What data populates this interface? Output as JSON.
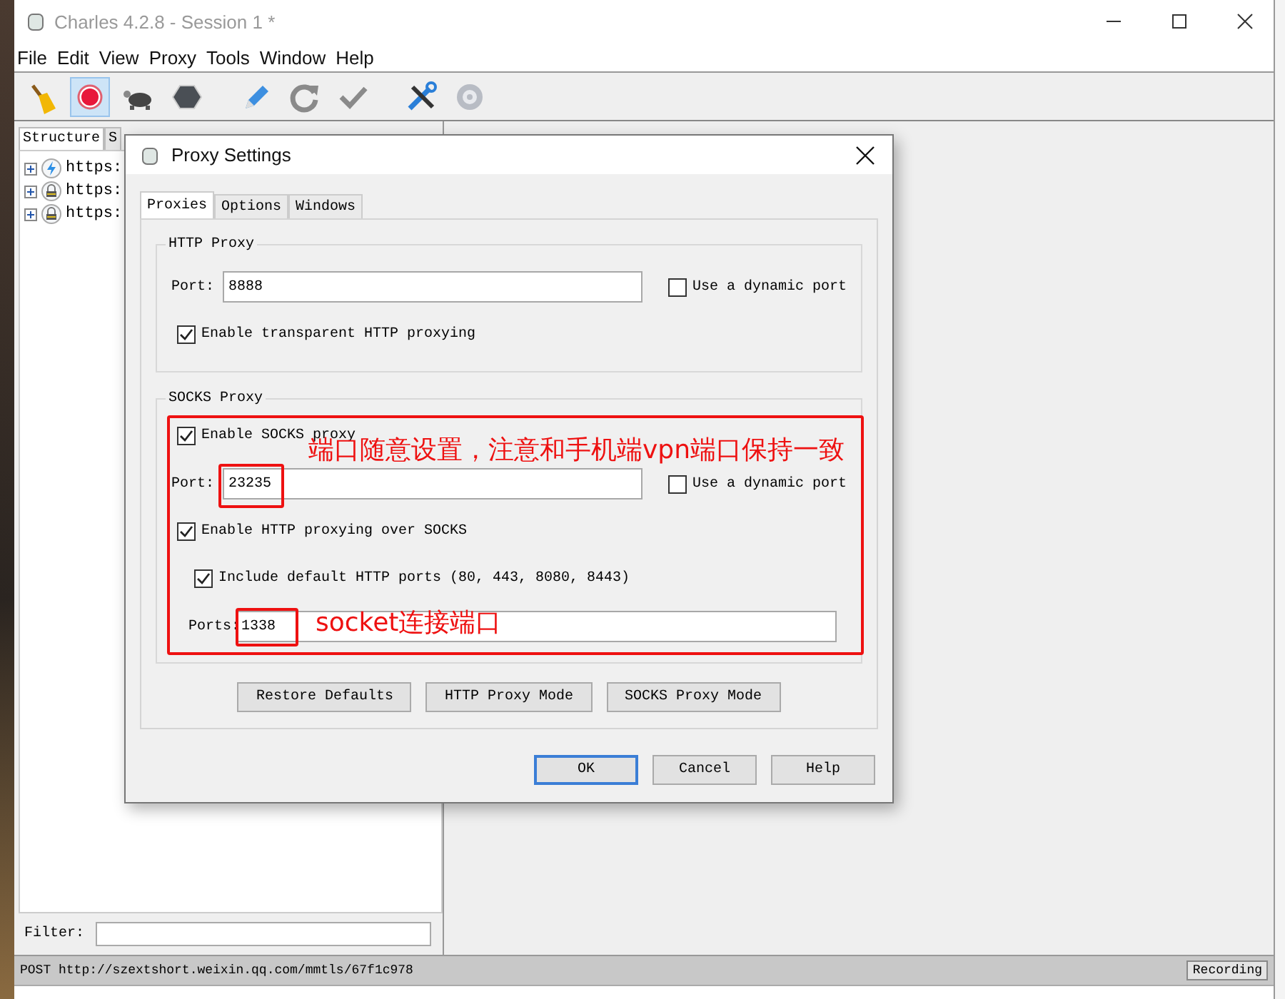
{
  "window": {
    "title": "Charles 4.2.8 - Session 1 *"
  },
  "menu": [
    "File",
    "Edit",
    "View",
    "Proxy",
    "Tools",
    "Window",
    "Help"
  ],
  "toolbar": [
    {
      "kind": "broom",
      "selected": false
    },
    {
      "kind": "record",
      "selected": true
    },
    {
      "kind": "turtle",
      "selected": false
    },
    {
      "kind": "stop",
      "selected": false
    },
    {
      "kind": "pen",
      "selected": false
    },
    {
      "kind": "refresh",
      "selected": false
    },
    {
      "kind": "check",
      "selected": false
    },
    {
      "kind": "tools",
      "selected": false
    },
    {
      "kind": "gear",
      "selected": false
    }
  ],
  "sidebar": {
    "tabs": [
      {
        "label": "Structure",
        "selected": true
      },
      {
        "label": "S",
        "selected": false
      }
    ],
    "tree": [
      {
        "label": "https:",
        "kind": "bolt"
      },
      {
        "label": "https:",
        "kind": "lock"
      },
      {
        "label": "https:",
        "kind": "lock"
      }
    ],
    "filter_label": "Filter:"
  },
  "status_bar": {
    "text": "POST http://szextshort.weixin.qq.com/mmtls/67f1c978",
    "badge": "Recording"
  },
  "dialog": {
    "title": "Proxy Settings",
    "tabs": [
      {
        "label": "Proxies",
        "selected": true
      },
      {
        "label": "Options",
        "selected": false
      },
      {
        "label": "Windows",
        "selected": false
      }
    ],
    "http_proxy": {
      "title": "HTTP Proxy",
      "port_label": "Port:",
      "port": "8888",
      "dynamic": {
        "label": "Use a dynamic port",
        "checked": false
      },
      "transparent": {
        "label": "Enable transparent HTTP proxying",
        "checked": true
      }
    },
    "socks_proxy": {
      "title": "SOCKS Proxy",
      "enable": {
        "label": "Enable SOCKS proxy",
        "checked": true
      },
      "port_label": "Port:",
      "port": "23235",
      "dynamic": {
        "label": "Use a dynamic port",
        "checked": false
      },
      "http_over": {
        "label": "Enable HTTP proxying over SOCKS",
        "checked": true
      },
      "include": {
        "label": "Include default HTTP ports (80, 443, 8080, 8443)",
        "checked": true
      },
      "ports_label": "Ports:",
      "ports": "1338"
    },
    "mode_buttons": [
      "Restore Defaults",
      "HTTP Proxy Mode",
      "SOCKS Proxy Mode"
    ],
    "buttons": [
      {
        "label": "OK",
        "selected": true
      },
      {
        "label": "Cancel",
        "selected": false
      },
      {
        "label": "Help",
        "selected": false
      }
    ]
  },
  "annotations": [
    "端口随意设置，注意和手机端vpn端口保持一致",
    "socket连接端口"
  ]
}
